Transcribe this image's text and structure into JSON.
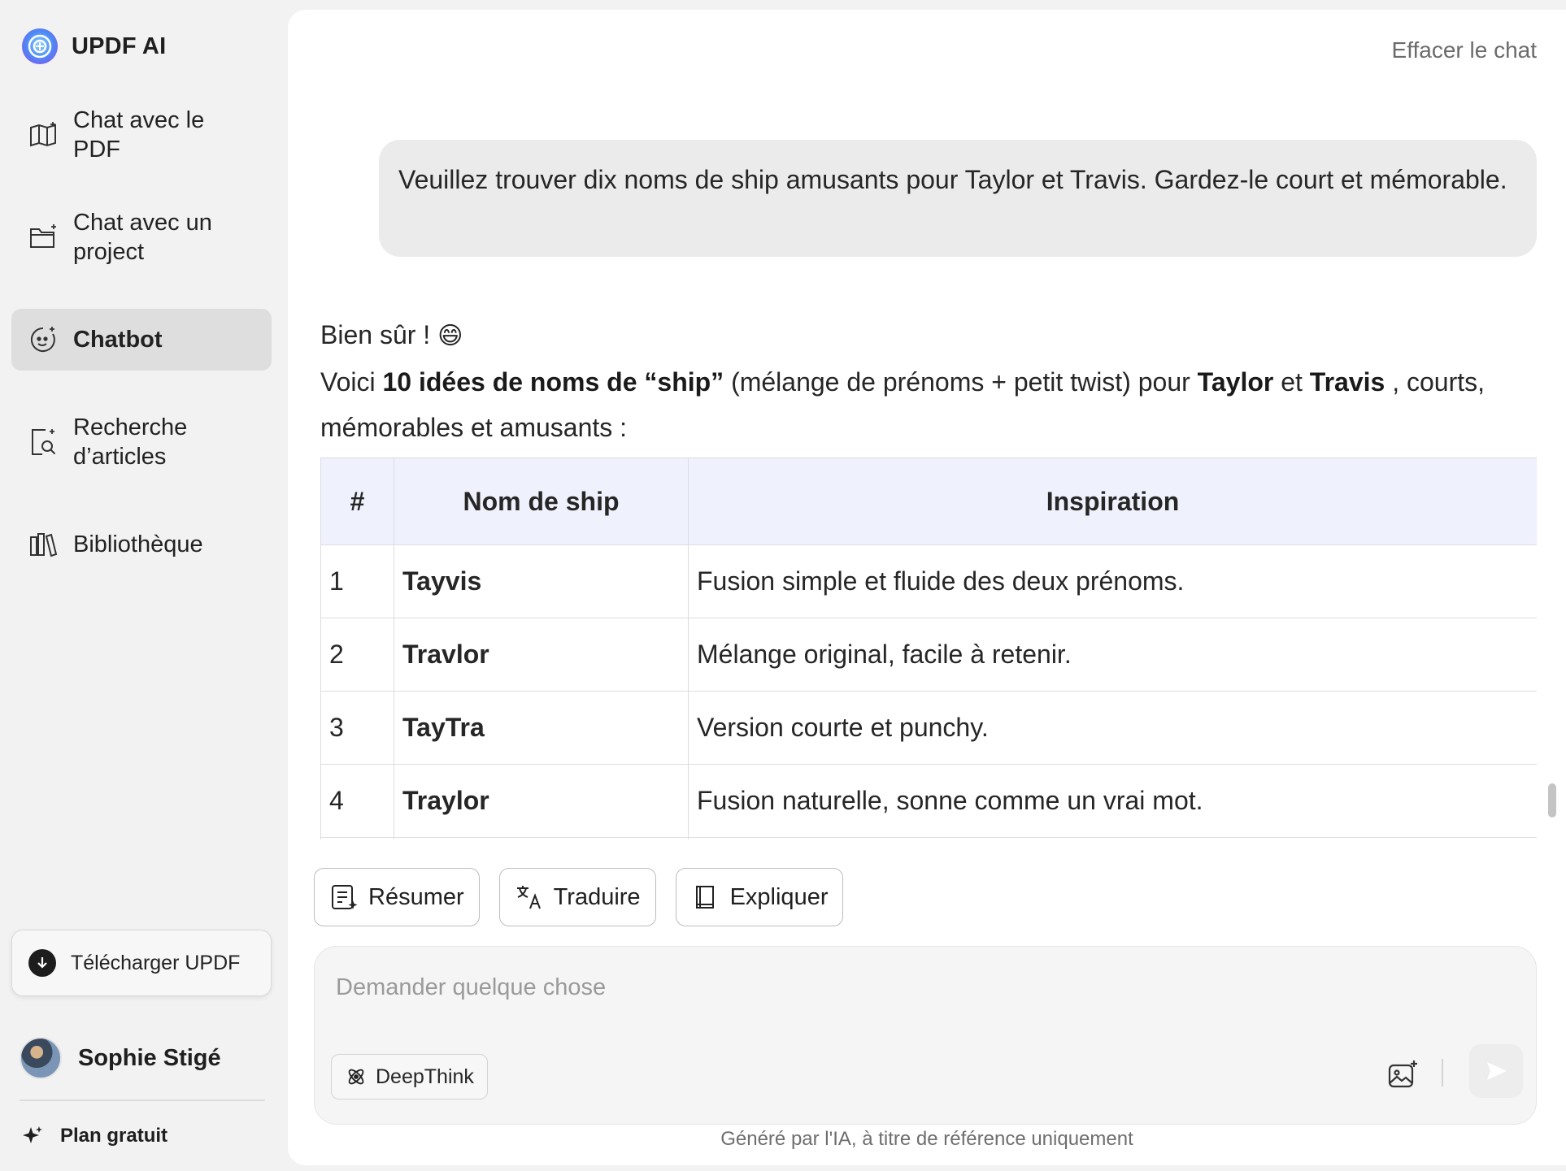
{
  "app": {
    "name": "UPDF AI"
  },
  "sidebar": {
    "items": [
      {
        "label": "Chat avec le PDF",
        "icon": "book-sparkle-icon"
      },
      {
        "label": "Chat avec un project",
        "icon": "folder-sparkle-icon"
      },
      {
        "label": "Chatbot",
        "icon": "chatbot-icon",
        "active": true
      },
      {
        "label": "Recherche d’articles",
        "icon": "document-search-icon"
      },
      {
        "label": "Bibliothèque",
        "icon": "library-icon"
      }
    ],
    "download_label": "Télécharger UPDF",
    "user_name": "Sophie Stigé",
    "plan_label": "Plan gratuit"
  },
  "header": {
    "clear_chat": "Effacer le chat"
  },
  "conversation": {
    "user_message": "Veuillez trouver dix noms de ship amusants pour Taylor et Travis. Gardez-le court et mémorable.",
    "answer": {
      "greeting": "Bien sûr !",
      "greeting_emoji": "😄",
      "intro_1": "Voici ",
      "intro_bold_1": "10 idées de noms de “ship”",
      "intro_2": " (mélange de prénoms + petit twist) pour ",
      "intro_bold_2": "Taylor",
      "intro_3": " et ",
      "intro_bold_3": "Travis",
      "intro_4": " , courts, mémorables et amusants :"
    },
    "table": {
      "headers": [
        "#",
        "Nom de ship",
        "Inspiration"
      ],
      "rows": [
        [
          "1",
          "Tayvis",
          "Fusion simple et fluide des deux prénoms."
        ],
        [
          "2",
          "Travlor",
          "Mélange original, facile à retenir."
        ],
        [
          "3",
          "TayTra",
          "Version courte et punchy."
        ],
        [
          "4",
          "Traylor",
          "Fusion naturelle, sonne comme un vrai mot."
        ]
      ]
    }
  },
  "quick_actions": [
    {
      "label": "Résumer",
      "icon": "summarize-icon"
    },
    {
      "label": "Traduire",
      "icon": "translate-icon"
    },
    {
      "label": "Expliquer",
      "icon": "book-icon"
    }
  ],
  "composer": {
    "placeholder": "Demander quelque chose",
    "deepthink_label": "DeepThink"
  },
  "footer_note": "Généré par l'IA, à titre de référence uniquement",
  "colors": {
    "accent": "#3b82f6",
    "table_header_bg": "#eff2fc",
    "active_nav_bg": "#dedede"
  }
}
